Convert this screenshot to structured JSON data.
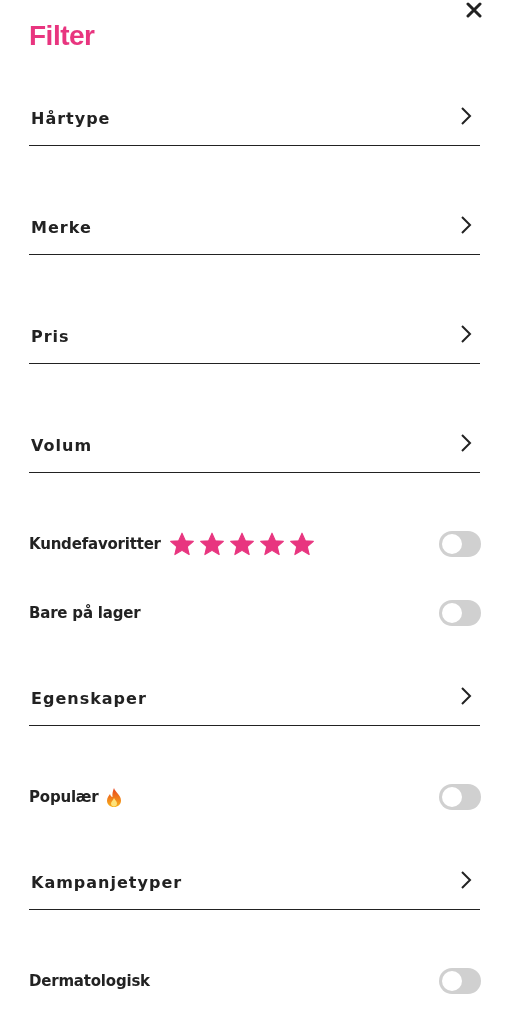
{
  "title": "Filter",
  "items": [
    {
      "kind": "link",
      "label": "Hårtype"
    },
    {
      "kind": "link",
      "label": "Merke"
    },
    {
      "kind": "link",
      "label": "Pris"
    },
    {
      "kind": "link",
      "label": "Volum"
    },
    {
      "kind": "toggle",
      "label": "Kundefavoritter",
      "stars": 5,
      "on": false
    },
    {
      "kind": "toggle",
      "label": "Bare på lager",
      "on": false
    },
    {
      "kind": "link",
      "label": "Egenskaper"
    },
    {
      "kind": "toggle",
      "label": "Populær",
      "flame": true,
      "on": false
    },
    {
      "kind": "link",
      "label": "Kampanjetyper"
    },
    {
      "kind": "toggle",
      "label": "Dermatologisk",
      "on": false
    }
  ]
}
